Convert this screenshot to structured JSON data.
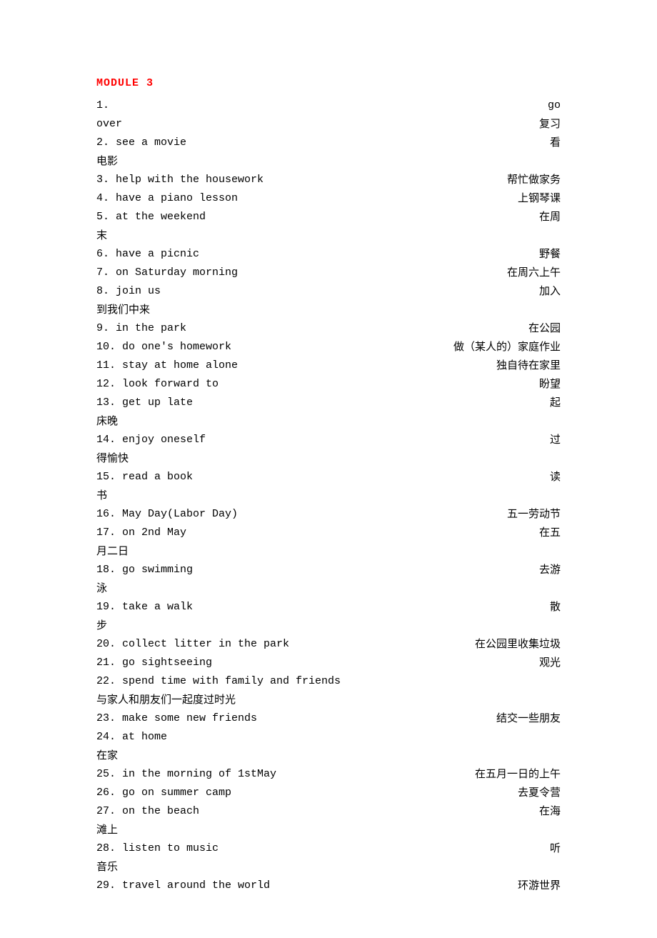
{
  "module_title": "MODULE 3",
  "entries": [
    {
      "num": "1.",
      "en": "",
      "zh_right": "go",
      "zh_cont": null,
      "en_cont": "over",
      "zh_cont2": "复习"
    },
    {
      "num": "2.",
      "en": "see a movie",
      "zh_right": "看",
      "zh_cont": "电影"
    },
    {
      "num": "3.",
      "en": "help with the housework",
      "zh_right": "帮忙做家务",
      "zh_cont": null
    },
    {
      "num": "4.",
      "en": "have a piano lesson",
      "zh_right": "上钢琴课",
      "zh_cont": null
    },
    {
      "num": "5.",
      "en": "at the weekend",
      "zh_right": "在周",
      "zh_cont": "末"
    },
    {
      "num": "6.",
      "en": "have a picnic",
      "zh_right": "野餐",
      "zh_cont": null
    },
    {
      "num": "7.",
      "en": "on Saturday morning",
      "zh_right": "在周六上午",
      "zh_cont": null
    },
    {
      "num": "8.",
      "en": "join us",
      "zh_right": "加入",
      "zh_cont": "到我们中来"
    },
    {
      "num": "9.",
      "en": "in the park",
      "zh_right": "在公园",
      "zh_cont": null
    },
    {
      "num": "10.",
      "en": "do one's homework",
      "zh_right": "做（某人的）家庭作业",
      "zh_cont": null
    },
    {
      "num": "11.",
      "en": "stay at home alone",
      "zh_right": "独自待在家里",
      "zh_cont": null
    },
    {
      "num": "12.",
      "en": "look forward to",
      "zh_right": "盼望",
      "zh_cont": null
    },
    {
      "num": "13.",
      "en": "get up late",
      "zh_right": "起",
      "zh_cont": "床晚"
    },
    {
      "num": "14.",
      "en": "enjoy oneself",
      "zh_right": "过",
      "zh_cont": "得愉快"
    },
    {
      "num": "15.",
      "en": "read a book",
      "zh_right": "读",
      "zh_cont": "书"
    },
    {
      "num": "16.",
      "en": "May Day(Labor Day)",
      "zh_right": "五一劳动节",
      "zh_cont": null
    },
    {
      "num": "17.",
      "en": "on 2nd May",
      "zh_right": "在五",
      "zh_cont": "月二日"
    },
    {
      "num": "18.",
      "en": "go swimming",
      "zh_right": "去游",
      "zh_cont": "泳"
    },
    {
      "num": "19.",
      "en": "take a walk",
      "zh_right": "散",
      "zh_cont": "步"
    },
    {
      "num": "20.",
      "en": "collect litter in the park",
      "zh_right": "在公园里收集垃圾",
      "zh_cont": null
    },
    {
      "num": "21.",
      "en": "go sightseeing",
      "zh_right": "观光",
      "zh_cont": null
    },
    {
      "num": "22.",
      "en": "spend time with family and friends",
      "zh_right": "",
      "zh_cont": "与家人和朋友们一起度过时光"
    },
    {
      "num": "23.",
      "en": "make some new friends",
      "zh_right": "结交一些朋友",
      "zh_cont": null
    },
    {
      "num": "24.",
      "en": "at home",
      "zh_right": "",
      "zh_cont": "在家"
    },
    {
      "num": "25.",
      "en": "in the morning of 1stMay",
      "zh_right": "在五月一日的上午",
      "zh_cont": null
    },
    {
      "num": "26.",
      "en": "go on summer camp",
      "zh_right": "去夏令营",
      "zh_cont": null
    },
    {
      "num": "27.",
      "en": "on the beach",
      "zh_right": "在海",
      "zh_cont": "滩上"
    },
    {
      "num": "28.",
      "en": "listen to music",
      "zh_right": "听",
      "zh_cont": "音乐"
    },
    {
      "num": "29.",
      "en": "travel around the world",
      "zh_right": "环游世界",
      "zh_cont": null
    }
  ]
}
